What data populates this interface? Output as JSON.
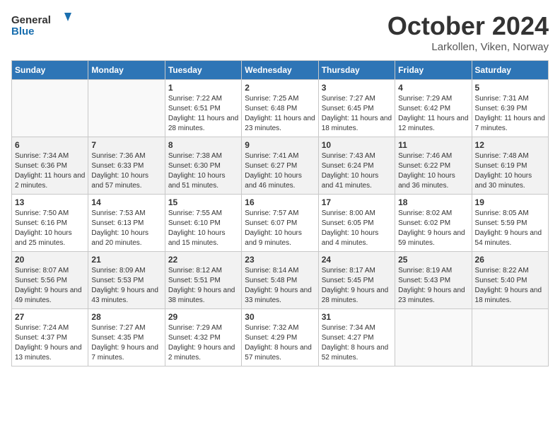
{
  "header": {
    "logo_general": "General",
    "logo_blue": "Blue",
    "month": "October 2024",
    "location": "Larkollen, Viken, Norway"
  },
  "days_of_week": [
    "Sunday",
    "Monday",
    "Tuesday",
    "Wednesday",
    "Thursday",
    "Friday",
    "Saturday"
  ],
  "weeks": [
    [
      {
        "day": "",
        "sunrise": "",
        "sunset": "",
        "daylight": ""
      },
      {
        "day": "",
        "sunrise": "",
        "sunset": "",
        "daylight": ""
      },
      {
        "day": "1",
        "sunrise": "Sunrise: 7:22 AM",
        "sunset": "Sunset: 6:51 PM",
        "daylight": "Daylight: 11 hours and 28 minutes."
      },
      {
        "day": "2",
        "sunrise": "Sunrise: 7:25 AM",
        "sunset": "Sunset: 6:48 PM",
        "daylight": "Daylight: 11 hours and 23 minutes."
      },
      {
        "day": "3",
        "sunrise": "Sunrise: 7:27 AM",
        "sunset": "Sunset: 6:45 PM",
        "daylight": "Daylight: 11 hours and 18 minutes."
      },
      {
        "day": "4",
        "sunrise": "Sunrise: 7:29 AM",
        "sunset": "Sunset: 6:42 PM",
        "daylight": "Daylight: 11 hours and 12 minutes."
      },
      {
        "day": "5",
        "sunrise": "Sunrise: 7:31 AM",
        "sunset": "Sunset: 6:39 PM",
        "daylight": "Daylight: 11 hours and 7 minutes."
      }
    ],
    [
      {
        "day": "6",
        "sunrise": "Sunrise: 7:34 AM",
        "sunset": "Sunset: 6:36 PM",
        "daylight": "Daylight: 11 hours and 2 minutes."
      },
      {
        "day": "7",
        "sunrise": "Sunrise: 7:36 AM",
        "sunset": "Sunset: 6:33 PM",
        "daylight": "Daylight: 10 hours and 57 minutes."
      },
      {
        "day": "8",
        "sunrise": "Sunrise: 7:38 AM",
        "sunset": "Sunset: 6:30 PM",
        "daylight": "Daylight: 10 hours and 51 minutes."
      },
      {
        "day": "9",
        "sunrise": "Sunrise: 7:41 AM",
        "sunset": "Sunset: 6:27 PM",
        "daylight": "Daylight: 10 hours and 46 minutes."
      },
      {
        "day": "10",
        "sunrise": "Sunrise: 7:43 AM",
        "sunset": "Sunset: 6:24 PM",
        "daylight": "Daylight: 10 hours and 41 minutes."
      },
      {
        "day": "11",
        "sunrise": "Sunrise: 7:46 AM",
        "sunset": "Sunset: 6:22 PM",
        "daylight": "Daylight: 10 hours and 36 minutes."
      },
      {
        "day": "12",
        "sunrise": "Sunrise: 7:48 AM",
        "sunset": "Sunset: 6:19 PM",
        "daylight": "Daylight: 10 hours and 30 minutes."
      }
    ],
    [
      {
        "day": "13",
        "sunrise": "Sunrise: 7:50 AM",
        "sunset": "Sunset: 6:16 PM",
        "daylight": "Daylight: 10 hours and 25 minutes."
      },
      {
        "day": "14",
        "sunrise": "Sunrise: 7:53 AM",
        "sunset": "Sunset: 6:13 PM",
        "daylight": "Daylight: 10 hours and 20 minutes."
      },
      {
        "day": "15",
        "sunrise": "Sunrise: 7:55 AM",
        "sunset": "Sunset: 6:10 PM",
        "daylight": "Daylight: 10 hours and 15 minutes."
      },
      {
        "day": "16",
        "sunrise": "Sunrise: 7:57 AM",
        "sunset": "Sunset: 6:07 PM",
        "daylight": "Daylight: 10 hours and 9 minutes."
      },
      {
        "day": "17",
        "sunrise": "Sunrise: 8:00 AM",
        "sunset": "Sunset: 6:05 PM",
        "daylight": "Daylight: 10 hours and 4 minutes."
      },
      {
        "day": "18",
        "sunrise": "Sunrise: 8:02 AM",
        "sunset": "Sunset: 6:02 PM",
        "daylight": "Daylight: 9 hours and 59 minutes."
      },
      {
        "day": "19",
        "sunrise": "Sunrise: 8:05 AM",
        "sunset": "Sunset: 5:59 PM",
        "daylight": "Daylight: 9 hours and 54 minutes."
      }
    ],
    [
      {
        "day": "20",
        "sunrise": "Sunrise: 8:07 AM",
        "sunset": "Sunset: 5:56 PM",
        "daylight": "Daylight: 9 hours and 49 minutes."
      },
      {
        "day": "21",
        "sunrise": "Sunrise: 8:09 AM",
        "sunset": "Sunset: 5:53 PM",
        "daylight": "Daylight: 9 hours and 43 minutes."
      },
      {
        "day": "22",
        "sunrise": "Sunrise: 8:12 AM",
        "sunset": "Sunset: 5:51 PM",
        "daylight": "Daylight: 9 hours and 38 minutes."
      },
      {
        "day": "23",
        "sunrise": "Sunrise: 8:14 AM",
        "sunset": "Sunset: 5:48 PM",
        "daylight": "Daylight: 9 hours and 33 minutes."
      },
      {
        "day": "24",
        "sunrise": "Sunrise: 8:17 AM",
        "sunset": "Sunset: 5:45 PM",
        "daylight": "Daylight: 9 hours and 28 minutes."
      },
      {
        "day": "25",
        "sunrise": "Sunrise: 8:19 AM",
        "sunset": "Sunset: 5:43 PM",
        "daylight": "Daylight: 9 hours and 23 minutes."
      },
      {
        "day": "26",
        "sunrise": "Sunrise: 8:22 AM",
        "sunset": "Sunset: 5:40 PM",
        "daylight": "Daylight: 9 hours and 18 minutes."
      }
    ],
    [
      {
        "day": "27",
        "sunrise": "Sunrise: 7:24 AM",
        "sunset": "Sunset: 4:37 PM",
        "daylight": "Daylight: 9 hours and 13 minutes."
      },
      {
        "day": "28",
        "sunrise": "Sunrise: 7:27 AM",
        "sunset": "Sunset: 4:35 PM",
        "daylight": "Daylight: 9 hours and 7 minutes."
      },
      {
        "day": "29",
        "sunrise": "Sunrise: 7:29 AM",
        "sunset": "Sunset: 4:32 PM",
        "daylight": "Daylight: 9 hours and 2 minutes."
      },
      {
        "day": "30",
        "sunrise": "Sunrise: 7:32 AM",
        "sunset": "Sunset: 4:29 PM",
        "daylight": "Daylight: 8 hours and 57 minutes."
      },
      {
        "day": "31",
        "sunrise": "Sunrise: 7:34 AM",
        "sunset": "Sunset: 4:27 PM",
        "daylight": "Daylight: 8 hours and 52 minutes."
      },
      {
        "day": "",
        "sunrise": "",
        "sunset": "",
        "daylight": ""
      },
      {
        "day": "",
        "sunrise": "",
        "sunset": "",
        "daylight": ""
      }
    ]
  ]
}
